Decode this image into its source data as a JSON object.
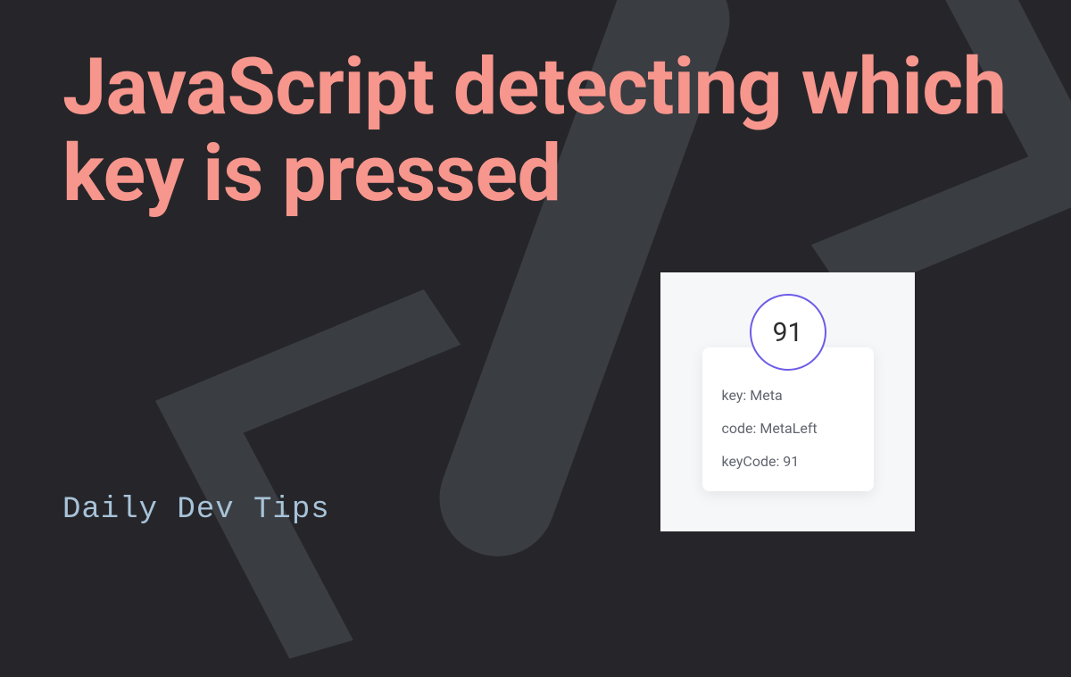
{
  "title": "JavaScript detecting which key is pressed",
  "brand": "Daily Dev Tips",
  "demo": {
    "keycode_display": "91",
    "rows": {
      "key_label": "key: Meta",
      "code_label": "code: MetaLeft",
      "keycode_label": "keyCode: 91"
    }
  },
  "colors": {
    "bg": "#26262a",
    "accent": "#f7968d",
    "brand_text": "#a8c3d9",
    "circle_border": "#6c5ce7"
  }
}
